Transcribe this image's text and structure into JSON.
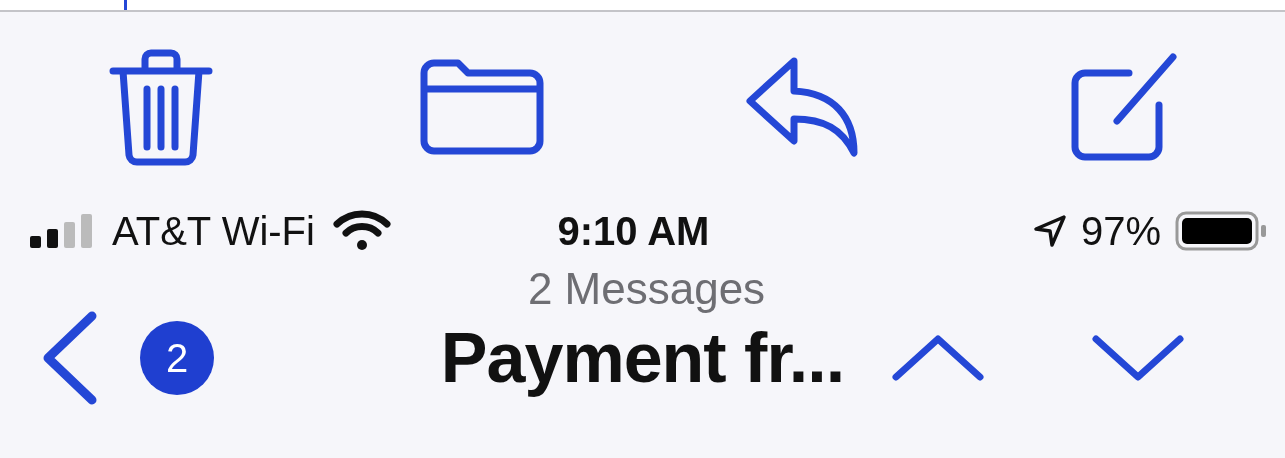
{
  "toolbar": {
    "buttons": [
      {
        "kind": "trash"
      },
      {
        "kind": "folder"
      },
      {
        "kind": "reply"
      },
      {
        "kind": "compose"
      }
    ]
  },
  "status_bar": {
    "carrier": "AT&T Wi-Fi",
    "time": "9:10 AM",
    "battery": "97%"
  },
  "header": {
    "subtitle": "2 Messages",
    "badge": "2",
    "title": "Payment fr...",
    "nav_buttons": [
      {
        "kind": "previous"
      },
      {
        "kind": "next"
      }
    ]
  }
}
